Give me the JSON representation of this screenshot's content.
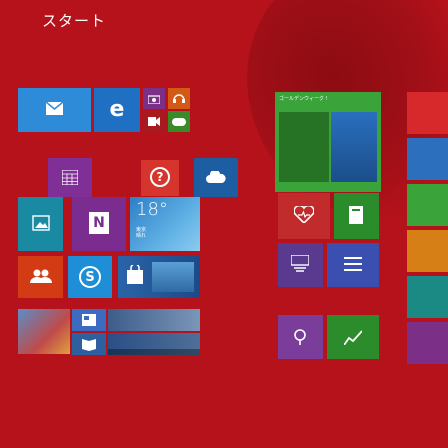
{
  "start": {
    "title": "スタート"
  },
  "tiles": {
    "mail": {
      "icon": "mail-icon"
    },
    "ie": {
      "icon": "internet-explorer-icon",
      "glyph": "e"
    },
    "camera": {
      "icon": "camera-icon"
    },
    "music": {
      "icon": "headphones-icon"
    },
    "video": {
      "icon": "video-icon"
    },
    "games": {
      "icon": "game-controller-icon"
    },
    "calendar": {
      "icon": "calendar-icon"
    },
    "help": {
      "icon": "help-icon",
      "glyph": "?"
    },
    "onedrive": {
      "icon": "cloud-icon"
    },
    "photos": {
      "icon": "photos-icon"
    },
    "onenote": {
      "icon": "onenote-icon",
      "glyph": "N"
    },
    "weather": {
      "temp": "18°",
      "city": "東京",
      "condition": "晴れ"
    },
    "people": {
      "icon": "people-icon"
    },
    "skype": {
      "icon": "skype-icon",
      "glyph": "S"
    },
    "store": {
      "icon": "store-icon"
    },
    "golden_week": {
      "header": "ゴールデンウィーク !"
    },
    "health": {
      "icon": "heart-icon"
    },
    "reading": {
      "icon": "book-icon"
    },
    "sports": {
      "icon": "trophy-icon"
    },
    "news": {
      "icon": "news-icon"
    },
    "maps": {
      "icon": "map-icon"
    },
    "finance": {
      "icon": "chart-icon"
    }
  },
  "colors": {
    "background": "#b5121b",
    "blue": "#2e8bd8",
    "dark_blue": "#1f5fa8",
    "purple": "#5a3a8e",
    "green": "#3aa33a",
    "teal": "#1b8a84",
    "orange": "#d77f17"
  }
}
